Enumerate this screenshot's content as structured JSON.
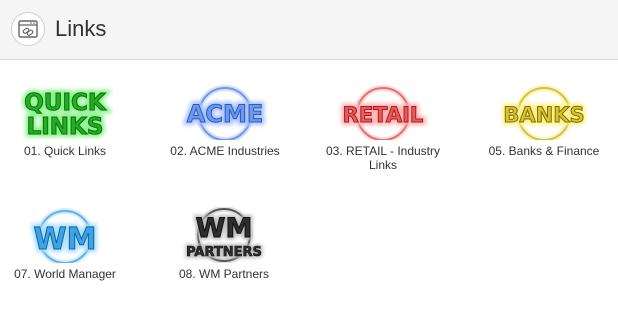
{
  "header": {
    "title": "Links",
    "icon": "browser-link-icon"
  },
  "tiles": [
    {
      "label": "01. Quick Links",
      "logo_text": [
        "QUICK",
        "LINKS"
      ],
      "color": "#22b022",
      "glow": "#7df07d"
    },
    {
      "label": "02. ACME Industries",
      "logo_text": [
        "ACME"
      ],
      "color": "#4d7fe0",
      "glow": "#a8c4ff"
    },
    {
      "label": "03. RETAIL - Industry Links",
      "logo_text": [
        "RETAIL"
      ],
      "color": "#e04343",
      "glow": "#ffb0b0"
    },
    {
      "label": "05. Banks & Finance",
      "logo_text": [
        "BANKS"
      ],
      "color": "#d7c430",
      "glow": "#fff08a"
    },
    {
      "label": "07. World Manager",
      "logo_text": [
        "WM"
      ],
      "color": "#3ea2e6",
      "glow": "#a7dcff"
    },
    {
      "label": "08. WM Partners",
      "logo_text": [
        "WM",
        "PARTNERS"
      ],
      "color": "#3a3a3a",
      "glow": "#bdbdbd"
    }
  ]
}
